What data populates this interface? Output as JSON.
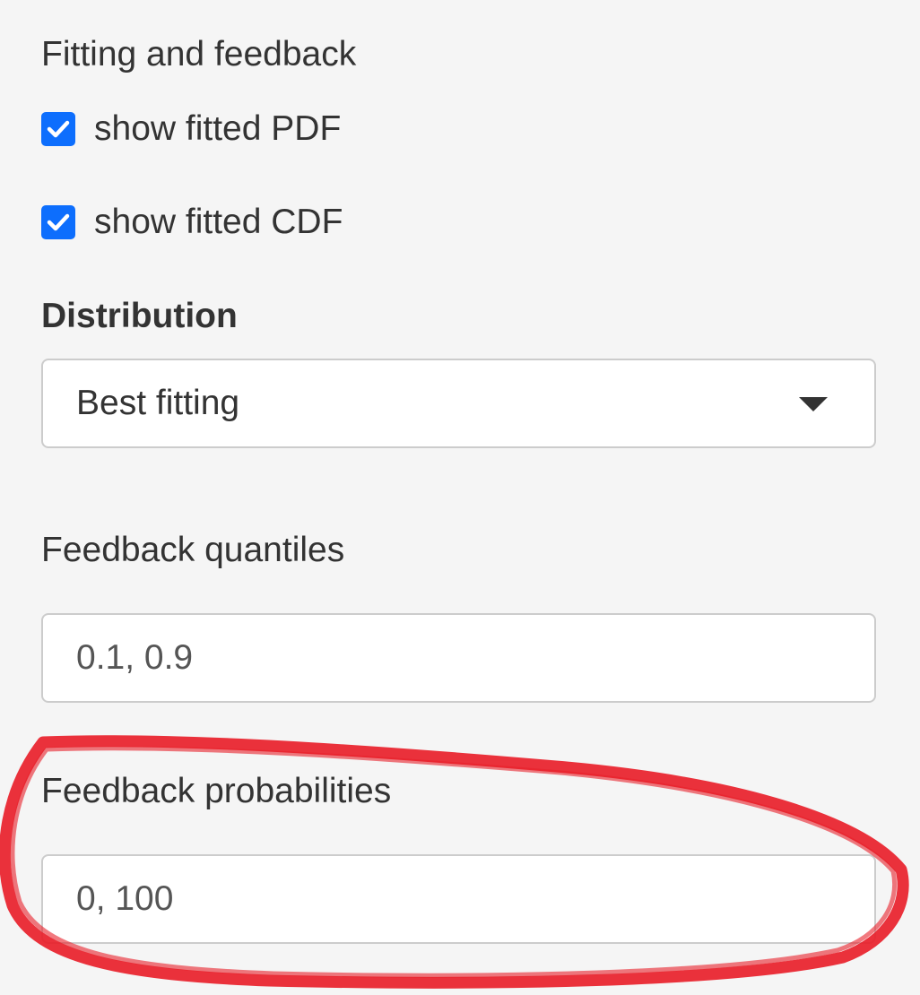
{
  "section": {
    "title": "Fitting and feedback"
  },
  "checkboxes": [
    {
      "label": "show fitted PDF",
      "checked": true
    },
    {
      "label": "show fitted CDF",
      "checked": true
    }
  ],
  "distribution": {
    "label": "Distribution",
    "selected": "Best fitting"
  },
  "quantiles": {
    "label": "Feedback quantiles",
    "value": "0.1, 0.9"
  },
  "probabilities": {
    "label": "Feedback probabilities",
    "value": "0, 100"
  },
  "colors": {
    "background": "#f5f5f5",
    "checkbox": "#0d6efd",
    "annotation": "#e8202a"
  },
  "icons": {
    "checkbox": "checkmark-icon",
    "dropdown": "caret-down-icon"
  }
}
